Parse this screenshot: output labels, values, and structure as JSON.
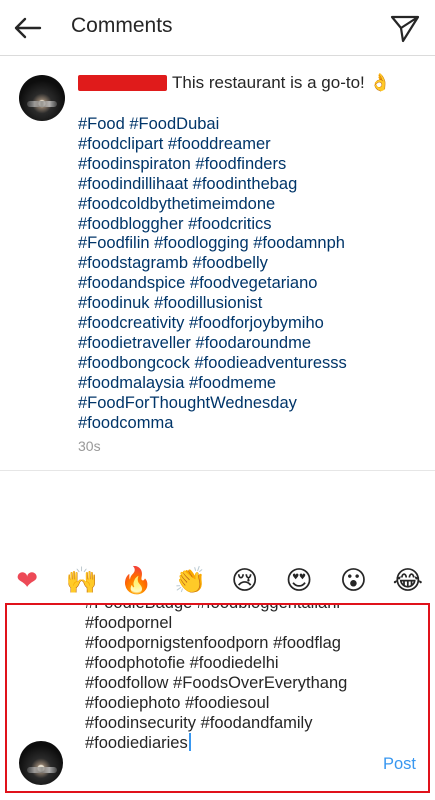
{
  "header": {
    "title": "Comments",
    "back_icon": "arrow-left-icon",
    "send_icon": "paper-plane-icon"
  },
  "post": {
    "caption_first_line": "This restaurant is a go-to! 👌",
    "hashtag_lines": [
      "#Food #FoodDubai",
      "#foodclipart #fooddreamer",
      "#foodinspiraton #foodfinders",
      "#foodindillihaat #foodinthebag",
      "#foodcoldbythetimeimdone",
      "#foodbloggher #foodcritics",
      "#Foodfilin #foodlogging #foodamnph",
      "#foodstagramb #foodbelly",
      "#foodandspice #foodvegetariano",
      "#foodinuk #foodillusionist",
      "#foodcreativity #foodforjoybymiho",
      "#foodietraveller #foodaroundme",
      "#foodbongcock #foodieadventuresss",
      "#foodmalaysia #foodmeme",
      "#FoodForThoughtWednesday",
      "#foodcomma"
    ],
    "timestamp": "30s"
  },
  "emoji_bar": {
    "emojis": [
      "❤",
      "🙌",
      "🔥",
      "👏",
      "😢",
      "😍",
      "😮",
      "😂"
    ],
    "icon_names": [
      "heart-emoji",
      "raised-hands-emoji",
      "fire-emoji",
      "clapping-hands-emoji",
      "sad-face-emoji",
      "heart-eyes-emoji",
      "surprised-face-emoji",
      "laughing-face-emoji"
    ]
  },
  "composer": {
    "text_lines": [
      "#FoodieBadge #foodbloggeritaliani",
      "#foodpornel",
      "#foodpornigstenfoodporn #foodflag",
      "#foodphotofie #foodiedelhi",
      "#foodfollow #FoodsOverEverythang",
      "#foodiephoto #foodiesoul",
      "#foodinsecurity #foodandfamily",
      "#foodiediaries"
    ],
    "post_label": "Post"
  },
  "colors": {
    "hashtag": "#003569",
    "post_button": "#3897f0",
    "highlight_border": "#e0121b",
    "redaction": "#e01b1b"
  }
}
